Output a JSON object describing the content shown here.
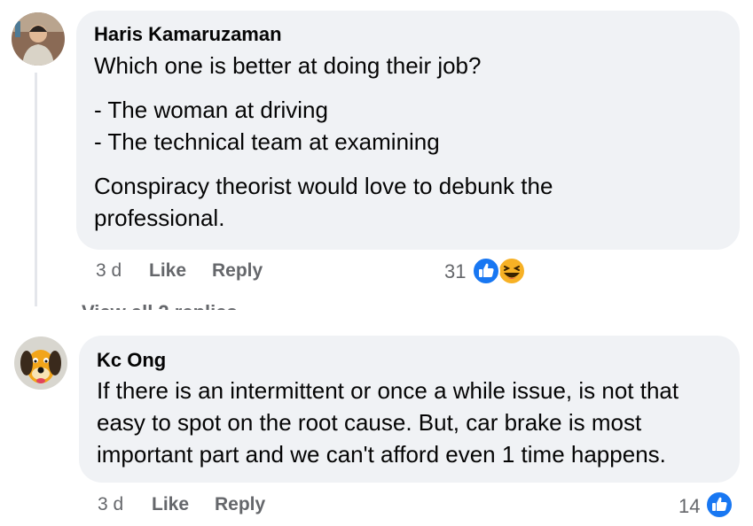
{
  "comments": [
    {
      "author": "Haris Kamaruzaman",
      "lines": [
        "Which one is better at doing their job?"
      ],
      "list": [
        "- The woman at driving",
        "- The technical team at examining"
      ],
      "closing": [
        "Conspiracy theorist would love to debunk the",
        "professional."
      ],
      "time": "3 d",
      "like_label": "Like",
      "reply_label": "Reply",
      "reaction_count": "31",
      "reactions": [
        "like-icon",
        "haha-icon"
      ]
    },
    {
      "author": "Kc Ong",
      "lines": [
        "If there is an intermittent or once a while issue, is not that",
        "easy to spot on the root cause. But, car brake is most",
        "important part and we can't afford even 1 time happens."
      ],
      "time": "3 d",
      "like_label": "Like",
      "reply_label": "Reply",
      "reaction_count": "14",
      "reactions": [
        "like-icon"
      ]
    }
  ],
  "colors": {
    "bubble": "#f0f2f5",
    "like_blue": "#1877f2",
    "meta_gray": "#65676b"
  }
}
